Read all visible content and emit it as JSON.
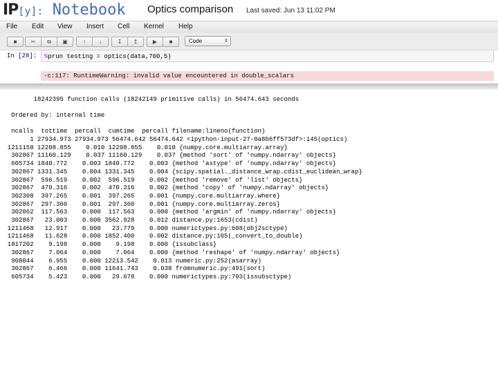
{
  "header": {
    "logo_ip": "IP",
    "logo_y": "[y]:",
    "logo_notebook": "Notebook",
    "notebook_name": "Optics comparison",
    "last_saved": "Last saved: Jun 13 11:02 PM"
  },
  "menubar": [
    "File",
    "Edit",
    "View",
    "Insert",
    "Cell",
    "Kernel",
    "Help"
  ],
  "toolbar": {
    "cell_type": "Code",
    "dropdown_arrow": "⇕"
  },
  "cell": {
    "prompt": "In [28]:",
    "magic": "%",
    "code": "prun testing = optics(data,700,5)"
  },
  "warning": "-c:117: RuntimeWarning: invalid value encountered in double_scalars",
  "profile": {
    "summary": "         18242395 function calls (18242149 primitive calls) in 56474.643 seconds",
    "ordered": "   Ordered by: internal time",
    "header": "   ncalls  tottime  percall  cumtime  percall filename:lineno(function)",
    "rows": [
      "        1 27934.973 27934.973 56474.642 56474.642 <ipython-input-27-0a8b6ff573df>:145(optics)",
      "  1211158 12208.855    0.010 12208.855    0.010 {numpy.core.multiarray.array}",
      "   302867 11160.129    0.037 11160.129    0.037 {method 'sort' of 'numpy.ndarray' objects}",
      "   605734 1840.772    0.003 1840.772    0.003 {method 'astype' of 'numpy.ndarray' objects}",
      "   302867 1331.345    0.004 1331.345    0.004 {scipy.spatial._distance_wrap.cdist_euclidean_wrap}",
      "   302867  596.519    0.002  596.519    0.002 {method 'remove' of 'list' objects}",
      "   302867  470.316    0.002  470.316    0.002 {method 'copy' of 'numpy.ndarray' objects}",
      "   302308  397.265    0.001  397.265    0.001 {numpy.core.multiarray.where}",
      "   302867  297.360    0.001  297.360    0.001 {numpy.core.multiarray.zeros}",
      "   302062  117.563    0.000  117.563    0.000 {method 'argmin' of 'numpy.ndarray' objects}",
      "   302867   23.003    0.000 3562.928    0.012 distance.py:1653(cdist)",
      "  1211468   12.917    0.000   23.779    0.000 numerictypes.py:608(obj2sctype)",
      "  1211468   11.628    0.000 1852.400    0.002 distance.py:105(_convert_to_double)",
      "  1817202    9.198    0.000    9.198    0.000 {issubclass}",
      "   302867    7.064    0.000    7.064    0.000 {method 'reshape' of 'numpy.ndarray' objects}",
      "   908044    6.955    0.000 12213.542    0.013 numeric.py:252(asarray)",
      "   302867    6.466    0.000 11641.743    0.038 fromnumeric.py:491(sort)",
      "   605734    5.423    0.000   29.678    0.000 numerictypes.py:703(issubsctype)"
    ]
  }
}
